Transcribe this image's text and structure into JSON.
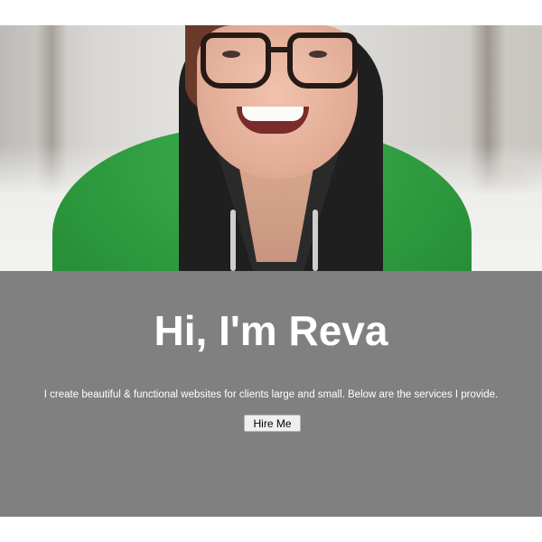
{
  "hero": {
    "image_subject": "portrait-photo"
  },
  "intro": {
    "title": "Hi, I'm Reva",
    "description": "I create beautiful & functional websites for clients large and small. Below are the services I provide.",
    "cta_label": "Hire Me"
  },
  "colors": {
    "band_background": "#808080",
    "title_color": "#ffffff",
    "text_color": "#ffffff",
    "button_background": "#efefef",
    "jacket_green": "#2e9a3e"
  }
}
